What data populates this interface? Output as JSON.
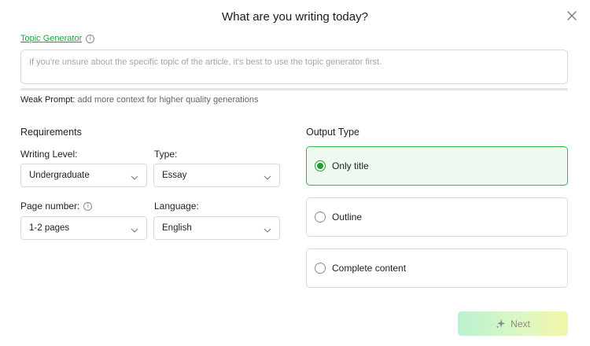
{
  "dialog": {
    "title": "What are you writing today?"
  },
  "topic_generator": {
    "label": "Topic Generator"
  },
  "prompt": {
    "placeholder": "If you're unsure about the specific topic of the article, it's best to use the topic generator first.",
    "value": ""
  },
  "prompt_strength": {
    "label": "Weak Prompt:",
    "hint": " add more context for higher quality generations"
  },
  "requirements": {
    "title": "Requirements",
    "writing_level": {
      "label": "Writing Level:",
      "value": "Undergraduate"
    },
    "type": {
      "label": "Type:",
      "value": "Essay"
    },
    "page_number": {
      "label": "Page number:",
      "value": "1-2 pages"
    },
    "language": {
      "label": "Language:",
      "value": "English"
    }
  },
  "output_type": {
    "title": "Output Type",
    "options": [
      {
        "label": "Only title",
        "selected": true
      },
      {
        "label": "Outline",
        "selected": false
      },
      {
        "label": "Complete content",
        "selected": false
      }
    ]
  },
  "next_button": {
    "label": "Next"
  },
  "colors": {
    "accent": "#22a33a",
    "selected_bg": "#eefaf0",
    "selected_border": "#34b34a"
  },
  "icons": [
    "close-icon",
    "info-icon",
    "chevron-down-icon",
    "sparkle-icon"
  ]
}
